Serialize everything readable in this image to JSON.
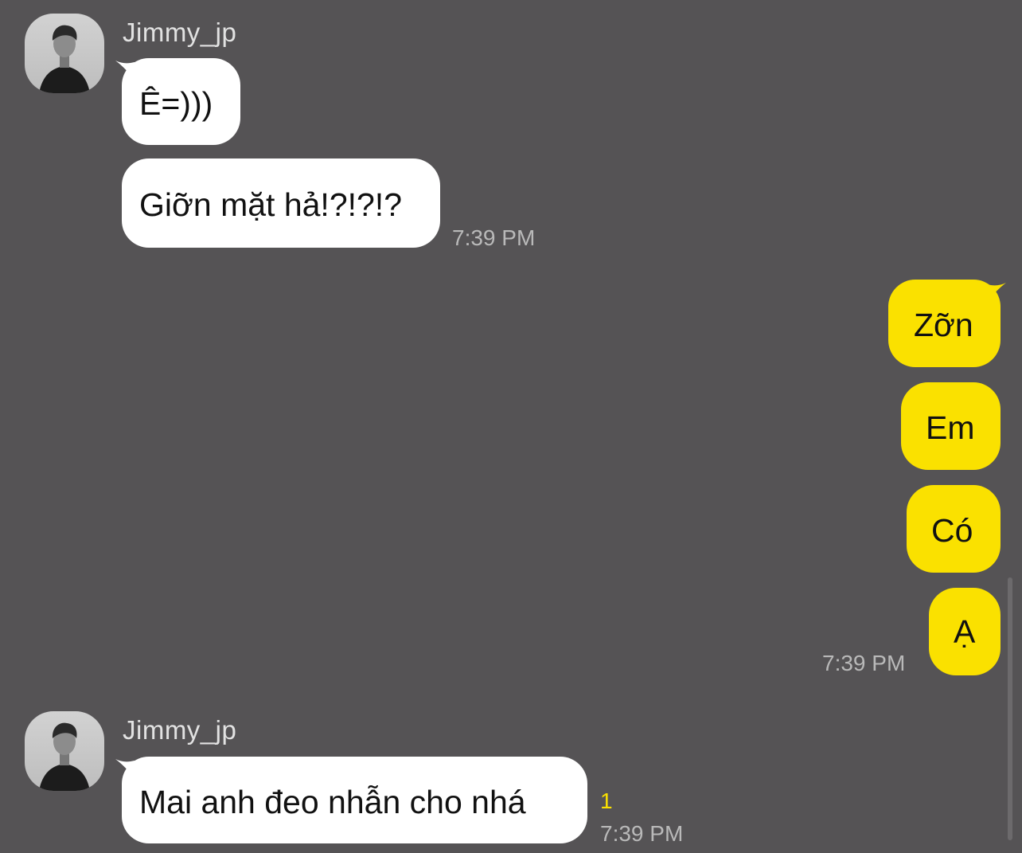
{
  "contact": {
    "name": "Jimmy_jp"
  },
  "colors": {
    "background": "#555355",
    "incoming_bubble": "#ffffff",
    "outgoing_bubble": "#fae100",
    "unread": "#fae100"
  },
  "messages": {
    "group1": {
      "m1": "Ê=)))",
      "m2": "Giỡn mặt hả!?!?!?",
      "time": "7:39 PM"
    },
    "group2": {
      "m1": "Zỡn",
      "m2": "Em",
      "m3": "Có",
      "m4": "Ạ",
      "time": "7:39 PM"
    },
    "group3": {
      "m1": "Mai anh đeo nhẫn cho nhá",
      "unread_count": "1",
      "time": "7:39 PM"
    }
  }
}
